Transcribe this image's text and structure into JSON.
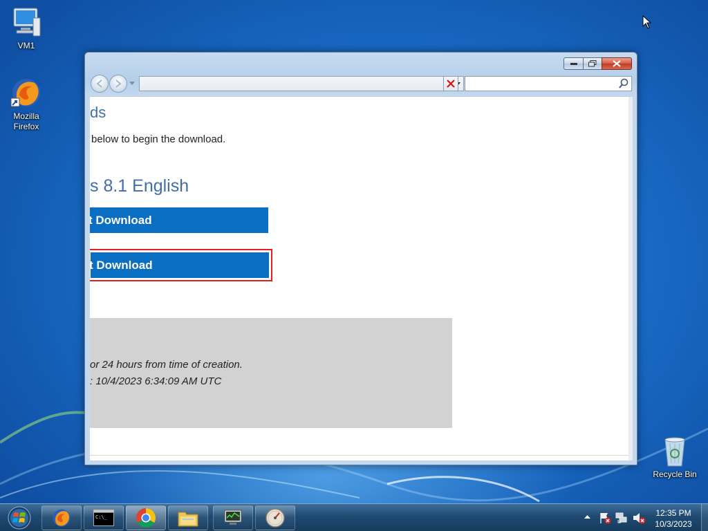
{
  "desktop": {
    "icons": [
      {
        "label": "VM1",
        "icon": "computer-icon"
      },
      {
        "label": "Mozilla\nFirefox",
        "icon": "firefox-icon"
      },
      {
        "label": "Recycle Bin",
        "icon": "recycle-bin-icon"
      }
    ]
  },
  "window": {
    "controls": {
      "minimize": "minimize",
      "maximize": "maximize",
      "close": "close"
    },
    "address_value": "",
    "search_value": ""
  },
  "page": {
    "heading_partial": "ds",
    "intro_partial": "below to begin the download.",
    "product_partial": "s 8.1 English",
    "button1_label": "t Download",
    "button2_label": "t Download",
    "info_line1": "or 24 hours from time of creation.",
    "info_line2": ": 10/4/2023 6:34:09 AM UTC"
  },
  "taskbar": {
    "start": "start-orb",
    "apps": [
      "firefox-icon",
      "cmd-icon",
      "chrome-icon",
      "explorer-icon",
      "network-monitor-icon",
      "performance-gauge-icon"
    ],
    "tray_icons": [
      "tray-expand-icon",
      "action-center-flag-icon",
      "network-icon",
      "volume-muted-icon"
    ],
    "clock_time": "12:35 PM",
    "clock_date": "10/3/2023"
  },
  "colors": {
    "accent": "#0a6fc2",
    "heading": "#3f6ea8",
    "highlight_border": "#e02020",
    "info_bg": "#d2d2d2"
  }
}
